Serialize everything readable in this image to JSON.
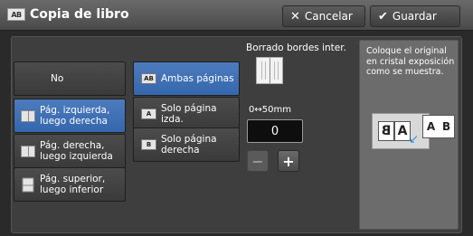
{
  "header": {
    "title_icon": "AB",
    "title": "Copia de libro",
    "cancel_label": "Cancelar",
    "save_label": "Guardar"
  },
  "options_left": [
    {
      "label": "No",
      "selected": false
    },
    {
      "label": "Pág. izquierda, luego derecha",
      "selected": true
    },
    {
      "label": "Pág. derecha, luego izquierda",
      "selected": false
    },
    {
      "label": "Pág. superior, luego inferior",
      "selected": false
    }
  ],
  "options_pages": [
    {
      "icon": "AB",
      "label": "Ambas páginas",
      "selected": true
    },
    {
      "icon": "A",
      "label": "Solo página izda.",
      "selected": false
    },
    {
      "icon": "B",
      "label": "Solo página derecha",
      "selected": false
    }
  ],
  "edge_erase": {
    "label": "Borrado bordes inter.",
    "range": "0↔50mm",
    "value": "0",
    "minus": "−",
    "plus": "+"
  },
  "info": {
    "text": "Coloque el original en cristal exposición como se muestra.",
    "page_left": "B",
    "page_right": "A",
    "result": [
      "A",
      "B"
    ]
  },
  "colors": {
    "accent": "#3567ad",
    "panel": "#3e3e3e",
    "arrow": "#2a8fd8"
  }
}
